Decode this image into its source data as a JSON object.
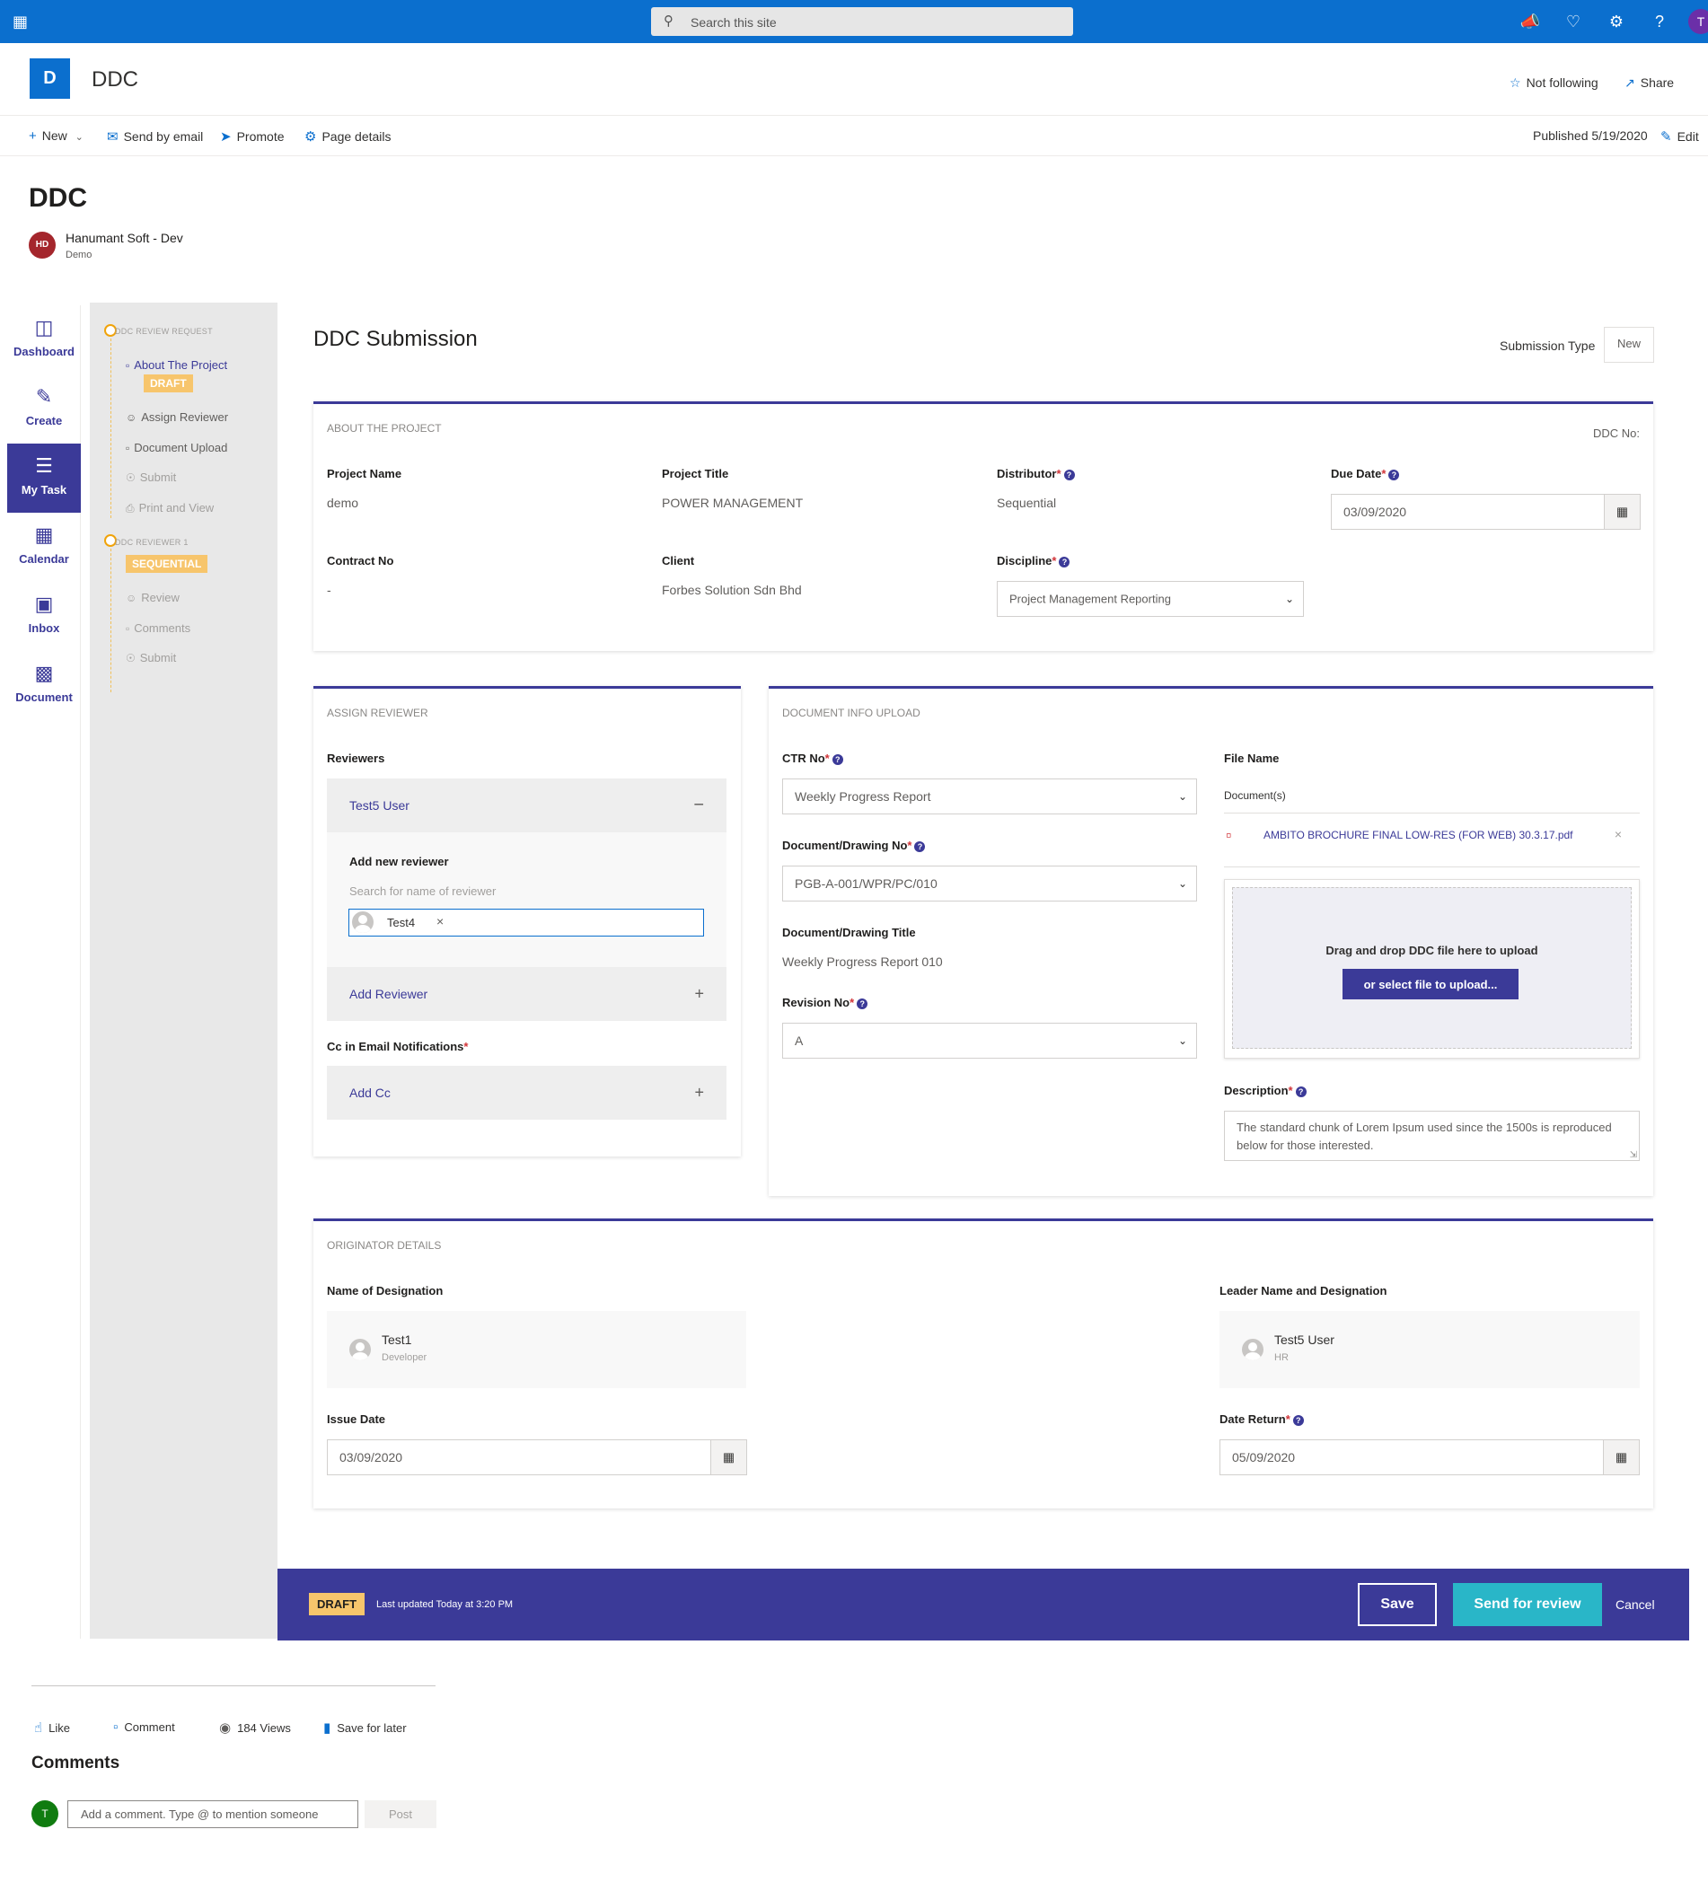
{
  "suitebar": {
    "search_placeholder": "Search this site",
    "avatar_initial": "T"
  },
  "site": {
    "logo_letter": "D",
    "title": "DDC",
    "not_following": "Not following",
    "share": "Share"
  },
  "commandbar": {
    "new": "New",
    "send_by_email": "Send by email",
    "promote": "Promote",
    "page_details": "Page details",
    "published": "Published 5/19/2020",
    "edit": "Edit"
  },
  "page": {
    "title": "DDC",
    "author_initials": "HD",
    "author_name": "Hanumant Soft - Dev",
    "author_sub": "Demo"
  },
  "leftnav": {
    "items": [
      {
        "label": "Dashboard",
        "icon": "dashboard-icon"
      },
      {
        "label": "Create",
        "icon": "edit-icon"
      },
      {
        "label": "My Task",
        "icon": "task-list-icon"
      },
      {
        "label": "Calendar",
        "icon": "calendar-icon"
      },
      {
        "label": "Inbox",
        "icon": "inbox-icon"
      },
      {
        "label": "Document",
        "icon": "document-icon"
      }
    ]
  },
  "steps": {
    "group1_header": "DDC REVIEW REQUEST",
    "about": "About The Project",
    "draft_tag": "DRAFT",
    "assign": "Assign Reviewer",
    "upload": "Document Upload",
    "submit1": "Submit",
    "print": "Print and View",
    "group2_header": "DDC REVIEWER 1",
    "sequential_tag": "SEQUENTIAL",
    "review": "Review",
    "comments": "Comments",
    "submit2": "Submit"
  },
  "form": {
    "title": "DDC Submission",
    "submission_type_label": "Submission Type",
    "submission_type_value": "New"
  },
  "about": {
    "card_title": "ABOUT THE PROJECT",
    "ddc_no": "DDC No:",
    "project_name_label": "Project Name",
    "project_name": "demo",
    "project_title_label": "Project Title",
    "project_title": "POWER MANAGEMENT",
    "distributor_label": "Distributor",
    "distributor": "Sequential",
    "due_date_label": "Due Date",
    "due_date": "03/09/2020",
    "contract_label": "Contract No",
    "contract": "-",
    "client_label": "Client",
    "client": "Forbes Solution Sdn Bhd",
    "discipline_label": "Discipline",
    "discipline": "Project Management Reporting"
  },
  "reviewer": {
    "card_title": "ASSIGN REVIEWER",
    "reviewers_label": "Reviewers",
    "reviewer1": "Test5 User",
    "add_new_label": "Add new reviewer",
    "search_hint": "Search for name of reviewer",
    "chip": "Test4",
    "add_reviewer": "Add Reviewer",
    "cc_label": "Cc in Email Notifications",
    "add_cc": "Add Cc"
  },
  "docinfo": {
    "card_title": "DOCUMENT INFO UPLOAD",
    "ctr_label": "CTR No",
    "ctr": "Weekly Progress Report",
    "drawing_no_label": "Document/Drawing No",
    "drawing_no": "PGB-A-001/WPR/PC/010",
    "drawing_title_label": "Document/Drawing Title",
    "drawing_title": "Weekly Progress Report 010",
    "revision_label": "Revision No",
    "revision": "A",
    "file_name_label": "File Name",
    "documents_label": "Document(s)",
    "file": "AMBITO BROCHURE FINAL LOW-RES (FOR WEB) 30.3.17.pdf",
    "drop_text": "Drag and drop DDC file here to upload",
    "select_btn": "or select file to upload...",
    "description_label": "Description",
    "description": "The standard chunk of Lorem Ipsum used since the 1500s is reproduced below for those interested."
  },
  "originator": {
    "card_title": "ORIGINATOR DETAILS",
    "name_label": "Name of Designation",
    "name": "Test1",
    "name_role": "Developer",
    "leader_label": "Leader Name and Designation",
    "leader": "Test5 User",
    "leader_role": "HR",
    "issue_label": "Issue Date",
    "issue": "03/09/2020",
    "return_label": "Date Return",
    "return": "05/09/2020"
  },
  "statusbar": {
    "draft": "DRAFT",
    "updated": "Last updated Today at 3:20 PM",
    "save": "Save",
    "send": "Send for review",
    "cancel": "Cancel"
  },
  "social": {
    "like": "Like",
    "comment": "Comment",
    "views": "184 Views",
    "save_later": "Save for later",
    "comments_title": "Comments",
    "commenter_initial": "T",
    "comment_placeholder": "Add a comment. Type @ to mention someone",
    "post": "Post"
  },
  "colors": {
    "suite_blue": "#0b6fce",
    "accent_indigo": "#3b3a98",
    "draft_orange": "#f7c56c",
    "review_cyan": "#29b6c8"
  }
}
